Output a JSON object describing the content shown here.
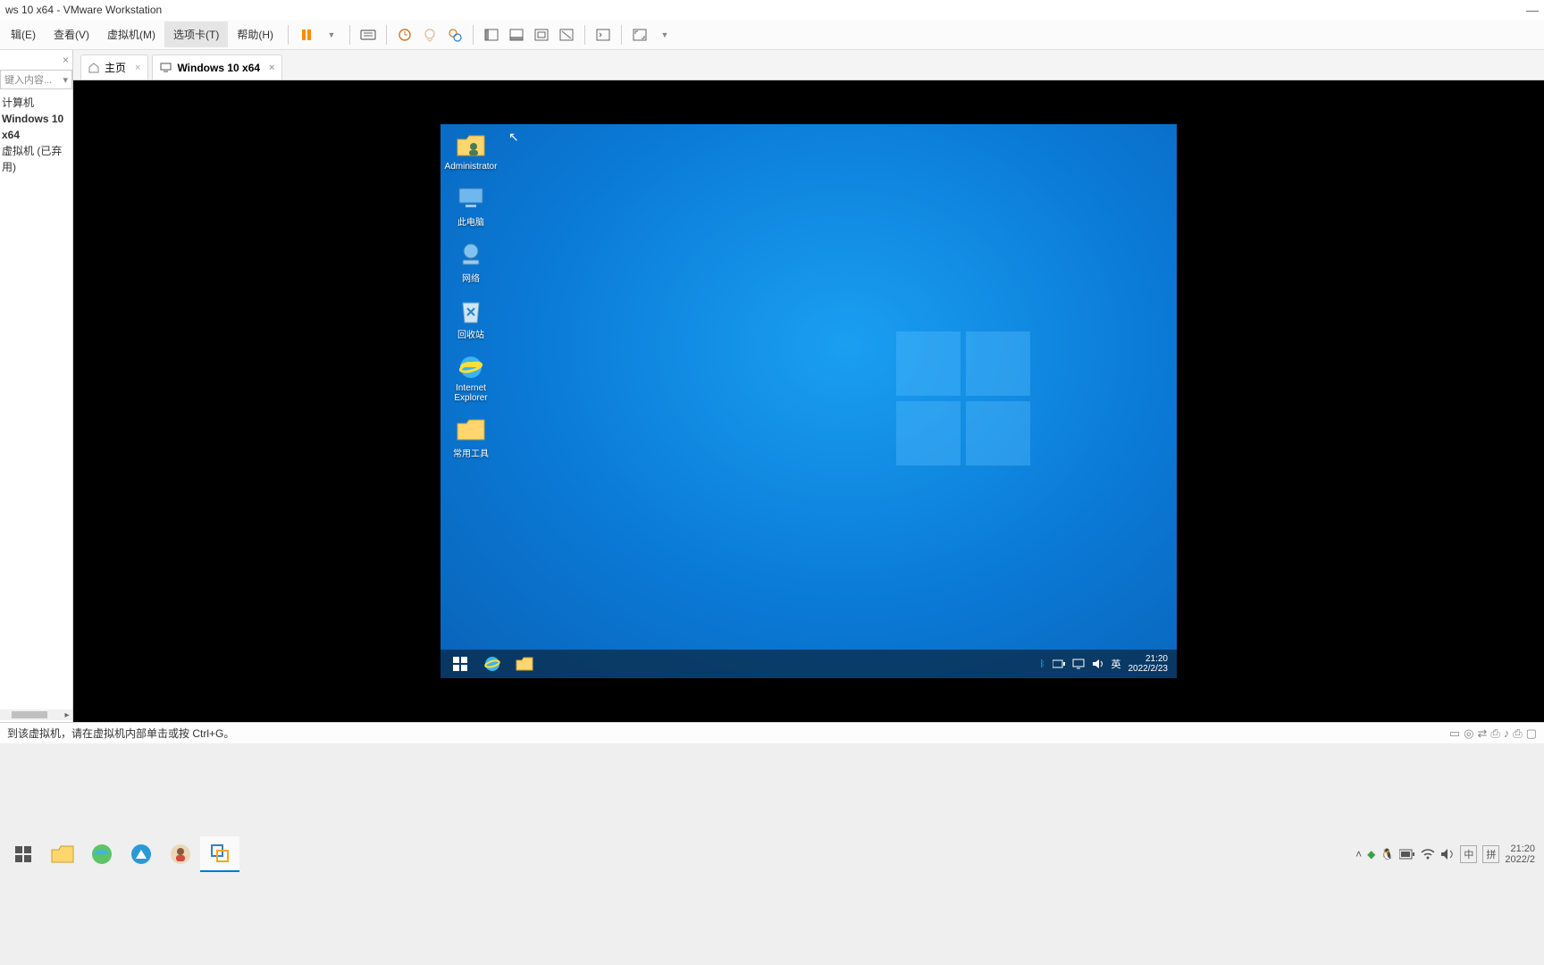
{
  "window": {
    "title": "ws 10 x64 - VMware Workstation"
  },
  "menu": {
    "items": [
      "辑(E)",
      "查看(V)",
      "虚拟机(M)",
      "选项卡(T)",
      "帮助(H)"
    ],
    "active_index": 3
  },
  "sidebar": {
    "filter_placeholder": "键入内容...",
    "items": [
      "计算机",
      "Windows 10 x64",
      "虚拟机 (已弃用)"
    ]
  },
  "tabs": [
    {
      "label": "主页",
      "icon": "home",
      "active": false
    },
    {
      "label": "Windows 10 x64",
      "icon": "monitor",
      "active": true
    }
  ],
  "guest": {
    "desktop_icons": [
      {
        "name": "admin",
        "label": "Administrator"
      },
      {
        "name": "thispc",
        "label": "此电脑"
      },
      {
        "name": "network",
        "label": "网络"
      },
      {
        "name": "recycle",
        "label": "回收站"
      },
      {
        "name": "ie",
        "label": "Internet Explorer"
      },
      {
        "name": "tools",
        "label": "常用工具"
      }
    ],
    "taskbar": {
      "ime": "英",
      "time": "21:20",
      "date": "2022/2/23"
    }
  },
  "status": {
    "hint": "到该虚拟机，请在虚拟机内部单击或按 Ctrl+G。"
  },
  "host": {
    "tray": {
      "ime_lang": "中",
      "ime_mode": "拼",
      "time": "21:20",
      "date": "2022/2"
    }
  }
}
